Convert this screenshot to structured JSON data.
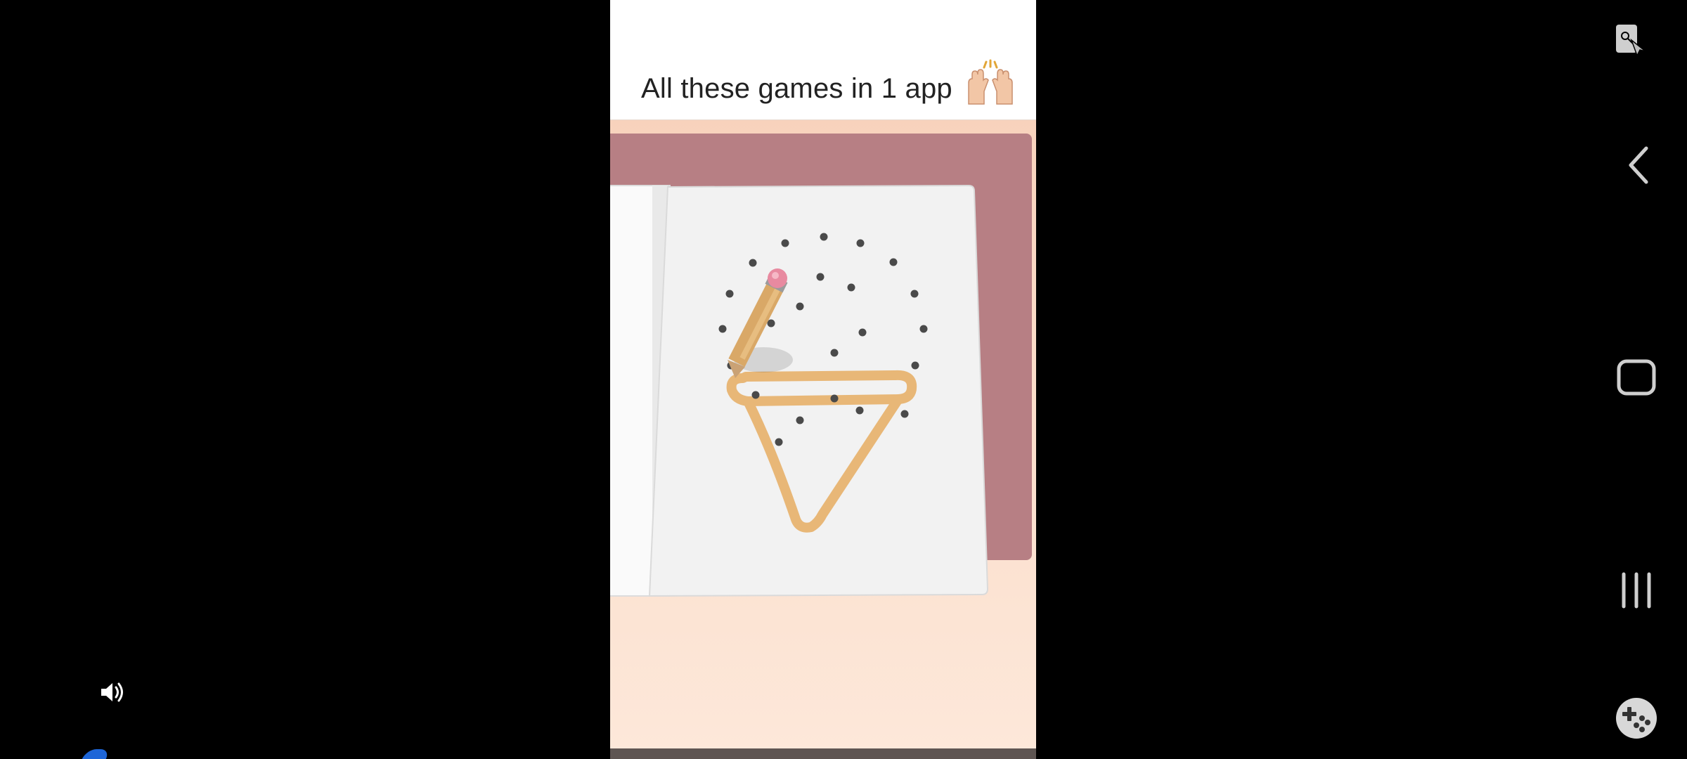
{
  "ad": {
    "title": "All these games in 1 app",
    "title_emoji": "raising-hands-icon"
  },
  "game_scene": {
    "drawing_subject": "ice-cream-cone",
    "trace_color": "#e8b777",
    "dot_color": "#4a4a4a",
    "book_cover_color": "#b77f84",
    "page_color": "#f3f3f3",
    "background_color": "#f8d9c5"
  },
  "system_nav": {
    "screen_lock": "screen-lock-icon",
    "back": "back-icon",
    "home": "home-icon",
    "recents": "recents-icon",
    "game_tools": "game-controller-icon"
  },
  "media": {
    "volume": "volume-icon"
  },
  "colors": {
    "accent_blue": "#1e66d8",
    "background": "#000000"
  }
}
